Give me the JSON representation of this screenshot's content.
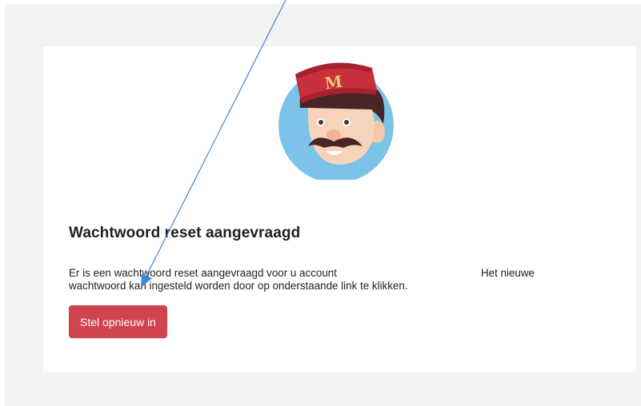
{
  "email": {
    "mascot_letter": "M",
    "heading": "Wachtwoord reset aangevraagd",
    "body_line1_start": "Er is een wachtwoord reset aangevraagd voor u account",
    "body_line1_end": "Het nieuwe",
    "body_line2": "wachtwoord kan ingesteld worden door op onderstaande link te klikken.",
    "button_label": "Stel opnieuw in"
  },
  "colors": {
    "page_background": "#f3f3f3",
    "card_background": "#ffffff",
    "button": "#d1434f",
    "annotation_arrow": "#3d87d8",
    "mascot_circle": "#7cc3ea",
    "mascot_hat": "#c8303c"
  },
  "icons": {
    "mascot": "bellhop-mascot-icon",
    "annotation": "blue-arrow-annotation"
  }
}
